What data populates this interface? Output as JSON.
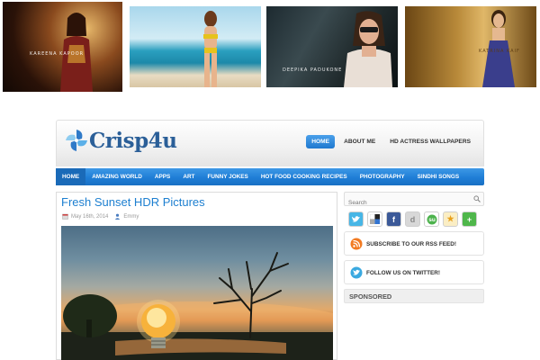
{
  "banner": {
    "thumbs": [
      {
        "caption": "KAREENA KAPOOR"
      },
      {
        "caption": ""
      },
      {
        "caption": "DEEPIKA PADUKONE"
      },
      {
        "caption": "KATRINA KAIF"
      }
    ]
  },
  "header": {
    "logo_text": "Crisp4u",
    "topnav": [
      {
        "label": "HOME",
        "active": true
      },
      {
        "label": "ABOUT ME",
        "active": false
      },
      {
        "label": "HD ACTRESS WALLPAPERS",
        "active": false
      }
    ]
  },
  "mainnav": {
    "items": [
      {
        "label": "HOME"
      },
      {
        "label": "AMAZING WORLD"
      },
      {
        "label": "APPS"
      },
      {
        "label": "ART"
      },
      {
        "label": "FUNNY JOKES"
      },
      {
        "label": "HOT FOOD COOKING RECIPES"
      },
      {
        "label": "PHOTOGRAPHY"
      },
      {
        "label": "SINDHI SONGS"
      }
    ]
  },
  "post": {
    "title": "Fresh Sunset HDR Pictures",
    "date": "May 16th, 2014",
    "author": "Emmy"
  },
  "sidebar": {
    "search_placeholder": "Search",
    "social_icons": [
      "twitter-icon",
      "delicious-icon",
      "facebook-icon",
      "digg-icon",
      "stumbleupon-icon",
      "favorites-icon",
      "add-icon"
    ],
    "rss_label": "SUBSCRIBE TO OUR RSS FEED!",
    "twitter_label": "FOLLOW US ON TWITTER!",
    "sponsored_label": "SPONSORED"
  },
  "colors": {
    "accent": "#1f7ed6",
    "title": "#1d7fd0"
  }
}
